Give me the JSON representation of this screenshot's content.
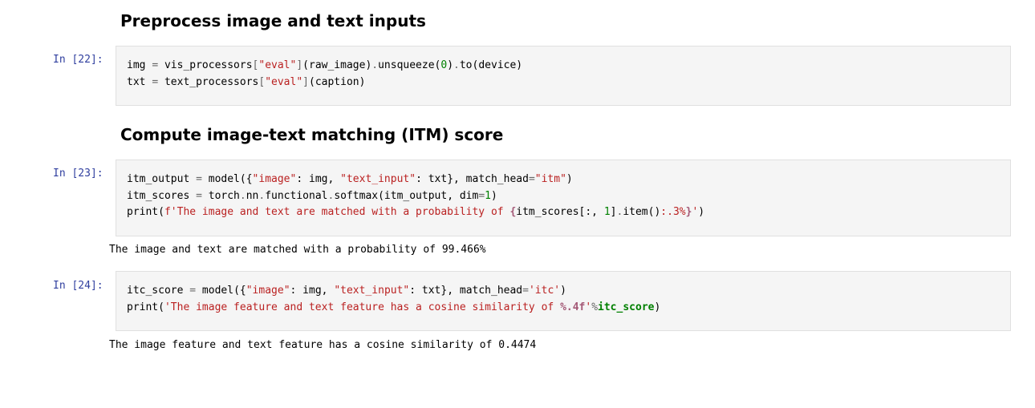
{
  "headings": {
    "preprocess": "Preprocess image and text inputs",
    "itm": "Compute image-text matching (ITM) score"
  },
  "cells": [
    {
      "prompt": "In [22]:",
      "lines": [
        [
          {
            "t": "img ",
            "c": ""
          },
          {
            "t": "=",
            "c": "op"
          },
          {
            "t": " vis_processors",
            "c": ""
          },
          {
            "t": "[",
            "c": "op"
          },
          {
            "t": "\"eval\"",
            "c": "str"
          },
          {
            "t": "]",
            "c": "op"
          },
          {
            "t": "(raw_image)",
            "c": ""
          },
          {
            "t": ".",
            "c": "op"
          },
          {
            "t": "unsqueeze(",
            "c": ""
          },
          {
            "t": "0",
            "c": "num"
          },
          {
            "t": ")",
            "c": ""
          },
          {
            "t": ".",
            "c": "op"
          },
          {
            "t": "to(device)",
            "c": ""
          }
        ],
        [
          {
            "t": "txt ",
            "c": ""
          },
          {
            "t": "=",
            "c": "op"
          },
          {
            "t": " text_processors",
            "c": ""
          },
          {
            "t": "[",
            "c": "op"
          },
          {
            "t": "\"eval\"",
            "c": "str"
          },
          {
            "t": "]",
            "c": "op"
          },
          {
            "t": "(caption)",
            "c": ""
          }
        ]
      ]
    },
    {
      "prompt": "In [23]:",
      "lines": [
        [
          {
            "t": "itm_output ",
            "c": ""
          },
          {
            "t": "=",
            "c": "op"
          },
          {
            "t": " model({",
            "c": ""
          },
          {
            "t": "\"image\"",
            "c": "str"
          },
          {
            "t": ": img, ",
            "c": ""
          },
          {
            "t": "\"text_input\"",
            "c": "str"
          },
          {
            "t": ": txt}, match_head",
            "c": ""
          },
          {
            "t": "=",
            "c": "op"
          },
          {
            "t": "\"itm\"",
            "c": "str"
          },
          {
            "t": ")",
            "c": ""
          }
        ],
        [
          {
            "t": "itm_scores ",
            "c": ""
          },
          {
            "t": "=",
            "c": "op"
          },
          {
            "t": " torch",
            "c": ""
          },
          {
            "t": ".",
            "c": "op"
          },
          {
            "t": "nn",
            "c": ""
          },
          {
            "t": ".",
            "c": "op"
          },
          {
            "t": "functional",
            "c": ""
          },
          {
            "t": ".",
            "c": "op"
          },
          {
            "t": "softmax(itm_output, dim",
            "c": ""
          },
          {
            "t": "=",
            "c": "op"
          },
          {
            "t": "1",
            "c": "num"
          },
          {
            "t": ")",
            "c": ""
          }
        ],
        [
          {
            "t": "print(",
            "c": ""
          },
          {
            "t": "f'The image and text are matched with a probability of ",
            "c": "str"
          },
          {
            "t": "{",
            "c": "int"
          },
          {
            "t": "itm_scores[:, ",
            "c": ""
          },
          {
            "t": "1",
            "c": "num"
          },
          {
            "t": "]",
            "c": ""
          },
          {
            "t": ".",
            "c": "op"
          },
          {
            "t": "item()",
            "c": ""
          },
          {
            "t": ":.3%",
            "c": "str"
          },
          {
            "t": "}",
            "c": "int"
          },
          {
            "t": "'",
            "c": "str"
          },
          {
            "t": ")",
            "c": ""
          }
        ]
      ],
      "output": "The image and text are matched with a probability of 99.466%"
    },
    {
      "prompt": "In [24]:",
      "lines": [
        [
          {
            "t": "itc_score ",
            "c": ""
          },
          {
            "t": "=",
            "c": "op"
          },
          {
            "t": " model({",
            "c": ""
          },
          {
            "t": "\"image\"",
            "c": "str"
          },
          {
            "t": ": img, ",
            "c": ""
          },
          {
            "t": "\"text_input\"",
            "c": "str"
          },
          {
            "t": ": txt}, match_head",
            "c": ""
          },
          {
            "t": "=",
            "c": "op"
          },
          {
            "t": "'itc'",
            "c": "str"
          },
          {
            "t": ")",
            "c": ""
          }
        ],
        [
          {
            "t": "print(",
            "c": ""
          },
          {
            "t": "'The image feature and text feature has a cosine similarity of ",
            "c": "str"
          },
          {
            "t": "%.4f",
            "c": "int"
          },
          {
            "t": "'",
            "c": "str"
          },
          {
            "t": "%",
            "c": "op"
          },
          {
            "t": "itc_score",
            "c": "kw"
          },
          {
            "t": ")",
            "c": ""
          }
        ]
      ],
      "output": "The image feature and text feature has a cosine similarity of 0.4474"
    }
  ]
}
